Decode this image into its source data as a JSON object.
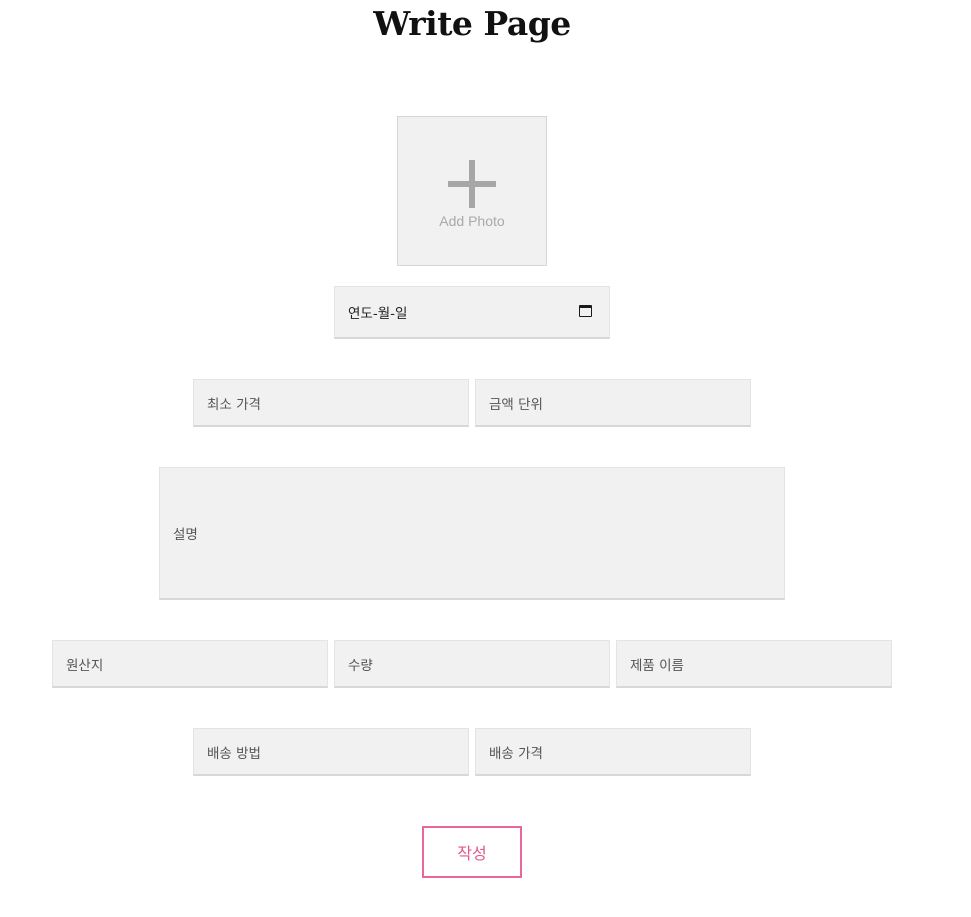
{
  "page": {
    "title": "Write Page"
  },
  "photo_upload": {
    "label": "Add Photo",
    "icon": "plus-icon"
  },
  "form": {
    "date": {
      "value": "연도-월-일",
      "icon": "calendar-icon"
    },
    "min_price": {
      "placeholder": "최소 가격"
    },
    "currency_unit": {
      "placeholder": "금액 단위"
    },
    "description": {
      "placeholder": "설명"
    },
    "origin": {
      "placeholder": "원산지"
    },
    "quantity": {
      "placeholder": "수량"
    },
    "product_name": {
      "placeholder": "제품 이름"
    },
    "shipping_method": {
      "placeholder": "배송 방법"
    },
    "shipping_price": {
      "placeholder": "배송 가격"
    },
    "submit_label": "작성"
  },
  "colors": {
    "field_background": "#f1f1f1",
    "accent": "#e9689c"
  }
}
